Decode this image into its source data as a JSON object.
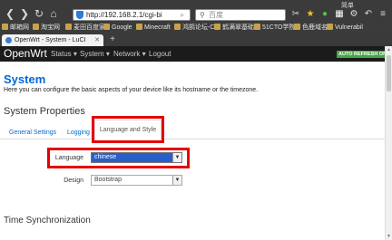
{
  "browser": {
    "url": "http://192.168.2.1/cgi-bi",
    "search_placeholder": "百度",
    "top_right_label": "简单",
    "tab_title": "OpenWrt - System - LuCI",
    "bookmarks": [
      "邮箱网",
      "淘宝网",
      "麦田百度家",
      "Google",
      "Minecraft",
      "鸿鹄论坛-C",
      "鹤满翠基础",
      "51CTO学院",
      "色鹿域名",
      "Vulnerabil"
    ]
  },
  "header": {
    "brand": "OpenWrt",
    "menu": [
      "Status",
      "System",
      "Network",
      "Logout"
    ],
    "auto_refresh": "AUTO REFRESH ON"
  },
  "page": {
    "title": "System",
    "description": "Here you can configure the basic aspects of your device like its hostname or the timezone.",
    "section_title": "System Properties",
    "tabs": [
      "General Settings",
      "Logging",
      "Language and Style"
    ],
    "active_tab": "Language and Style",
    "language_label": "Language",
    "language_value": "chinese",
    "design_label": "Design",
    "design_value": "Bootstrap",
    "section2_title": "Time Synchronization"
  },
  "colors": {
    "accent": "#0069d6",
    "highlight": "#e60000",
    "header_bg": "#1b1b1b",
    "auto_refresh_bg": "#46a546"
  }
}
